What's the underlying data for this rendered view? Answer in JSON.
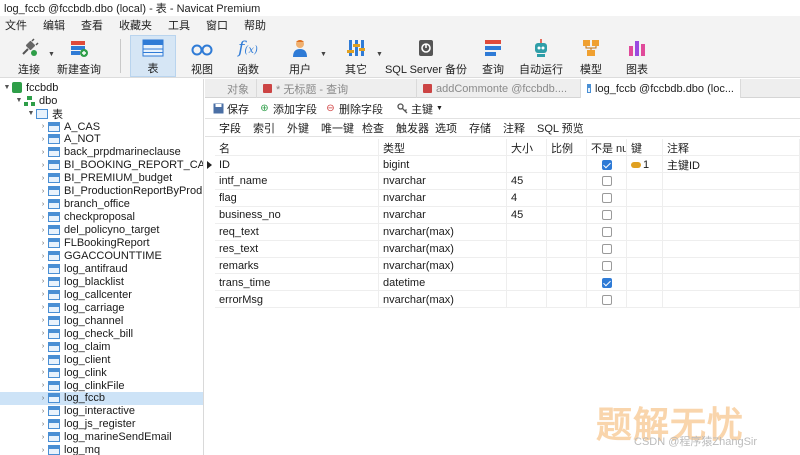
{
  "window": {
    "title": "log_fccb @fccbdb.dbo (local) - 表 - Navicat Premium"
  },
  "menu": [
    "文件",
    "编辑",
    "查看",
    "收藏夹",
    "工具",
    "窗口",
    "帮助"
  ],
  "toolbar": {
    "connect": "连接",
    "new_query": "新建查询",
    "table": "表",
    "view": "视图",
    "function": "函数",
    "user": "用户",
    "other": "其它",
    "backup": "SQL Server 备份",
    "query": "查询",
    "auto_run": "自动运行",
    "model": "模型",
    "chart": "图表"
  },
  "tree": {
    "database": "fccbdb",
    "schema": "dbo",
    "tables_folder": "表",
    "tables": [
      "A_CAS",
      "A_NOT",
      "back_prpdmarineclause",
      "BI_BOOKING_REPORT_CAS",
      "BI_PREMIUM_budget",
      "BI_ProductionReportByProd",
      "branch_office",
      "checkproposal",
      "del_policyno_target",
      "FLBookingReport",
      "GGACCOUNTTIME",
      "log_antifraud",
      "log_blacklist",
      "log_callcenter",
      "log_carriage",
      "log_channel",
      "log_check_bill",
      "log_claim",
      "log_client",
      "log_clink",
      "log_clinkFile",
      "log_fccb",
      "log_interactive",
      "log_js_register",
      "log_marineSendEmail",
      "log_mq"
    ],
    "selected_table": "log_fccb"
  },
  "tabs": [
    {
      "label": "对象"
    },
    {
      "label": "* 无标题 - 查询"
    },
    {
      "label": "addCommonte @fccbdb...."
    },
    {
      "label": "log_fccb @fccbdb.dbo (loc..."
    }
  ],
  "actions": {
    "save": "保存",
    "add_field": "添加字段",
    "delete_field": "删除字段",
    "primary_key": "主键"
  },
  "subtabs": [
    "字段",
    "索引",
    "外键",
    "唯一键",
    "检查",
    "触发器",
    "选项",
    "存储",
    "注释",
    "SQL 预览"
  ],
  "grid": {
    "headers": {
      "name": "名",
      "type": "类型",
      "size": "大小",
      "scale": "比例",
      "not_null": "不是 nu",
      "key": "键",
      "comment": "注释"
    },
    "rows": [
      {
        "name": "ID",
        "type": "bigint",
        "size": "",
        "scale": "",
        "not_null": true,
        "key": "1",
        "comment": "主键ID"
      },
      {
        "name": "intf_name",
        "type": "nvarchar",
        "size": "45",
        "scale": "",
        "not_null": false,
        "key": "",
        "comment": ""
      },
      {
        "name": "flag",
        "type": "nvarchar",
        "size": "4",
        "scale": "",
        "not_null": false,
        "key": "",
        "comment": ""
      },
      {
        "name": "business_no",
        "type": "nvarchar",
        "size": "45",
        "scale": "",
        "not_null": false,
        "key": "",
        "comment": ""
      },
      {
        "name": "req_text",
        "type": "nvarchar(max)",
        "size": "",
        "scale": "",
        "not_null": false,
        "key": "",
        "comment": ""
      },
      {
        "name": "res_text",
        "type": "nvarchar(max)",
        "size": "",
        "scale": "",
        "not_null": false,
        "key": "",
        "comment": ""
      },
      {
        "name": "remarks",
        "type": "nvarchar(max)",
        "size": "",
        "scale": "",
        "not_null": false,
        "key": "",
        "comment": ""
      },
      {
        "name": "trans_time",
        "type": "datetime",
        "size": "",
        "scale": "",
        "not_null": true,
        "key": "",
        "comment": ""
      },
      {
        "name": "errorMsg",
        "type": "nvarchar(max)",
        "size": "",
        "scale": "",
        "not_null": false,
        "key": "",
        "comment": ""
      }
    ]
  },
  "watermark": {
    "main": "题解无忧",
    "sub": "CSDN @程序猿ZhangSir"
  },
  "colors": {
    "accent": "#2f7bd6",
    "selection": "#cde3f7",
    "db_green": "#2e9e48"
  }
}
